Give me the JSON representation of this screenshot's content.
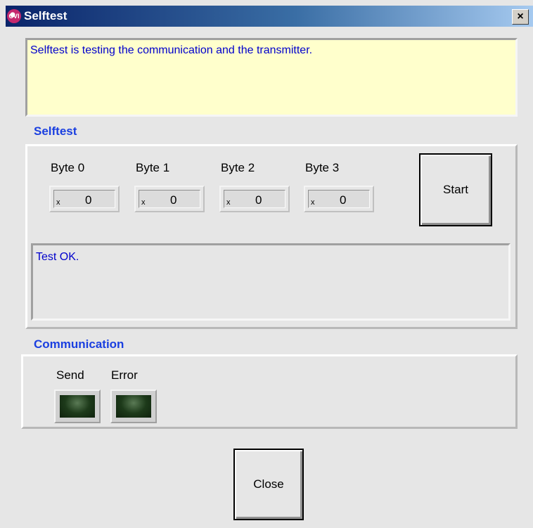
{
  "window": {
    "title": "Selftest",
    "icon_label": "CVI",
    "close_glyph": "×"
  },
  "info_message": "Selftest is testing the communication and the transmitter.",
  "selftest": {
    "section_label": "Selftest",
    "bytes": [
      {
        "label": "Byte 0",
        "prefix": "x",
        "value": "0"
      },
      {
        "label": "Byte 1",
        "prefix": "x",
        "value": "0"
      },
      {
        "label": "Byte 2",
        "prefix": "x",
        "value": "0"
      },
      {
        "label": "Byte 3",
        "prefix": "x",
        "value": "0"
      }
    ],
    "start_label": "Start",
    "status_text": "Test OK."
  },
  "communication": {
    "section_label": "Communication",
    "send_label": "Send",
    "error_label": "Error",
    "send_state": "off",
    "error_state": "off"
  },
  "close_label": "Close",
  "colors": {
    "section_label": "#1a3fe0",
    "message_text": "#0000cc",
    "info_background": "#ffffcc",
    "led_off": "#1d3a1a"
  }
}
